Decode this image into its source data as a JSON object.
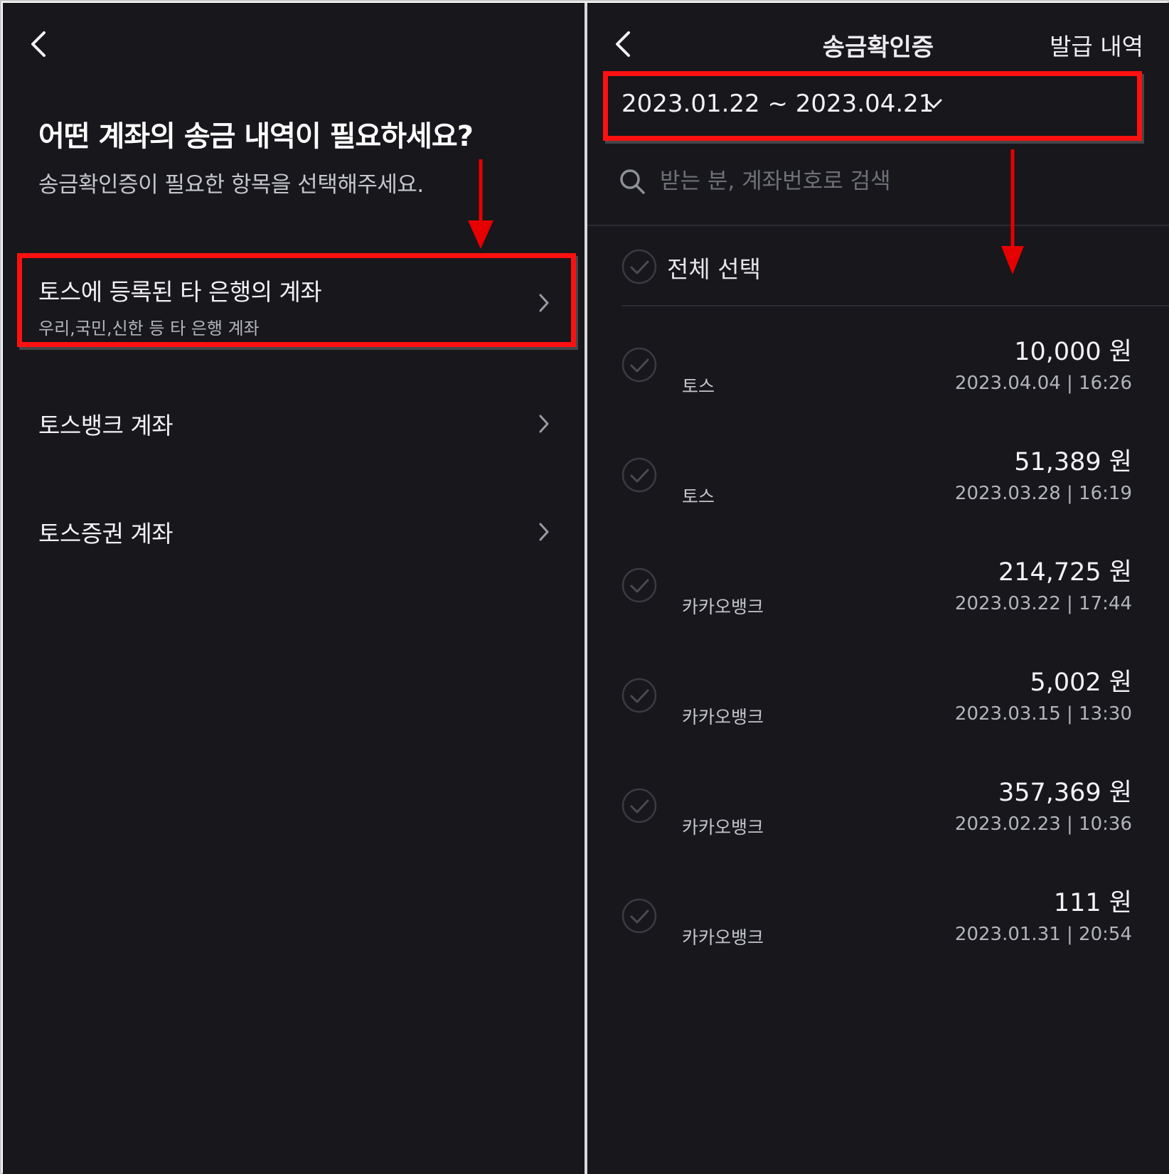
{
  "left": {
    "title": "어떤 계좌의 송금 내역이 필요하세요?",
    "subtitle": "송금확인증이 필요한 항목을 선택해주세요.",
    "accounts": [
      {
        "label": "토스에 등록된 타 은행의 계좌",
        "desc": "우리,국민,신한 등 타 은행 계좌"
      },
      {
        "label": "토스뱅크 계좌",
        "desc": ""
      },
      {
        "label": "토스증권 계좌",
        "desc": ""
      }
    ]
  },
  "right": {
    "title": "송금확인증",
    "history_label": "발급 내역",
    "date_range": "2023.01.22 ~ 2023.04.21",
    "search_placeholder": "받는 분, 계좌번호로 검색",
    "select_all_label": "전체 선택",
    "transactions": [
      {
        "name": "토스",
        "amount": "10,000 원",
        "datetime": "2023.04.04 | 16:26"
      },
      {
        "name": "토스",
        "amount": "51,389 원",
        "datetime": "2023.03.28 | 16:19"
      },
      {
        "name": "카카오뱅크",
        "amount": "214,725 원",
        "datetime": "2023.03.22 | 17:44"
      },
      {
        "name": "카카오뱅크",
        "amount": "5,002 원",
        "datetime": "2023.03.15 | 13:30"
      },
      {
        "name": "카카오뱅크",
        "amount": "357,369 원",
        "datetime": "2023.02.23 | 10:36"
      },
      {
        "name": "카카오뱅크",
        "amount": "111 원",
        "datetime": "2023.01.31 | 20:54"
      }
    ]
  },
  "icons": {
    "back": "chevron-left-icon",
    "row_chevron": "chevron-right-icon",
    "date_dropdown": "chevron-down-icon",
    "search": "search-icon",
    "check": "check-circle-icon",
    "annotation_arrow": "arrow-down-icon"
  },
  "colors": {
    "background": "#17171c",
    "highlight": "#ff1010",
    "annotation_arrow": "#e60000",
    "text_primary": "#f2f2f4",
    "text_secondary": "#b3b5bc"
  }
}
